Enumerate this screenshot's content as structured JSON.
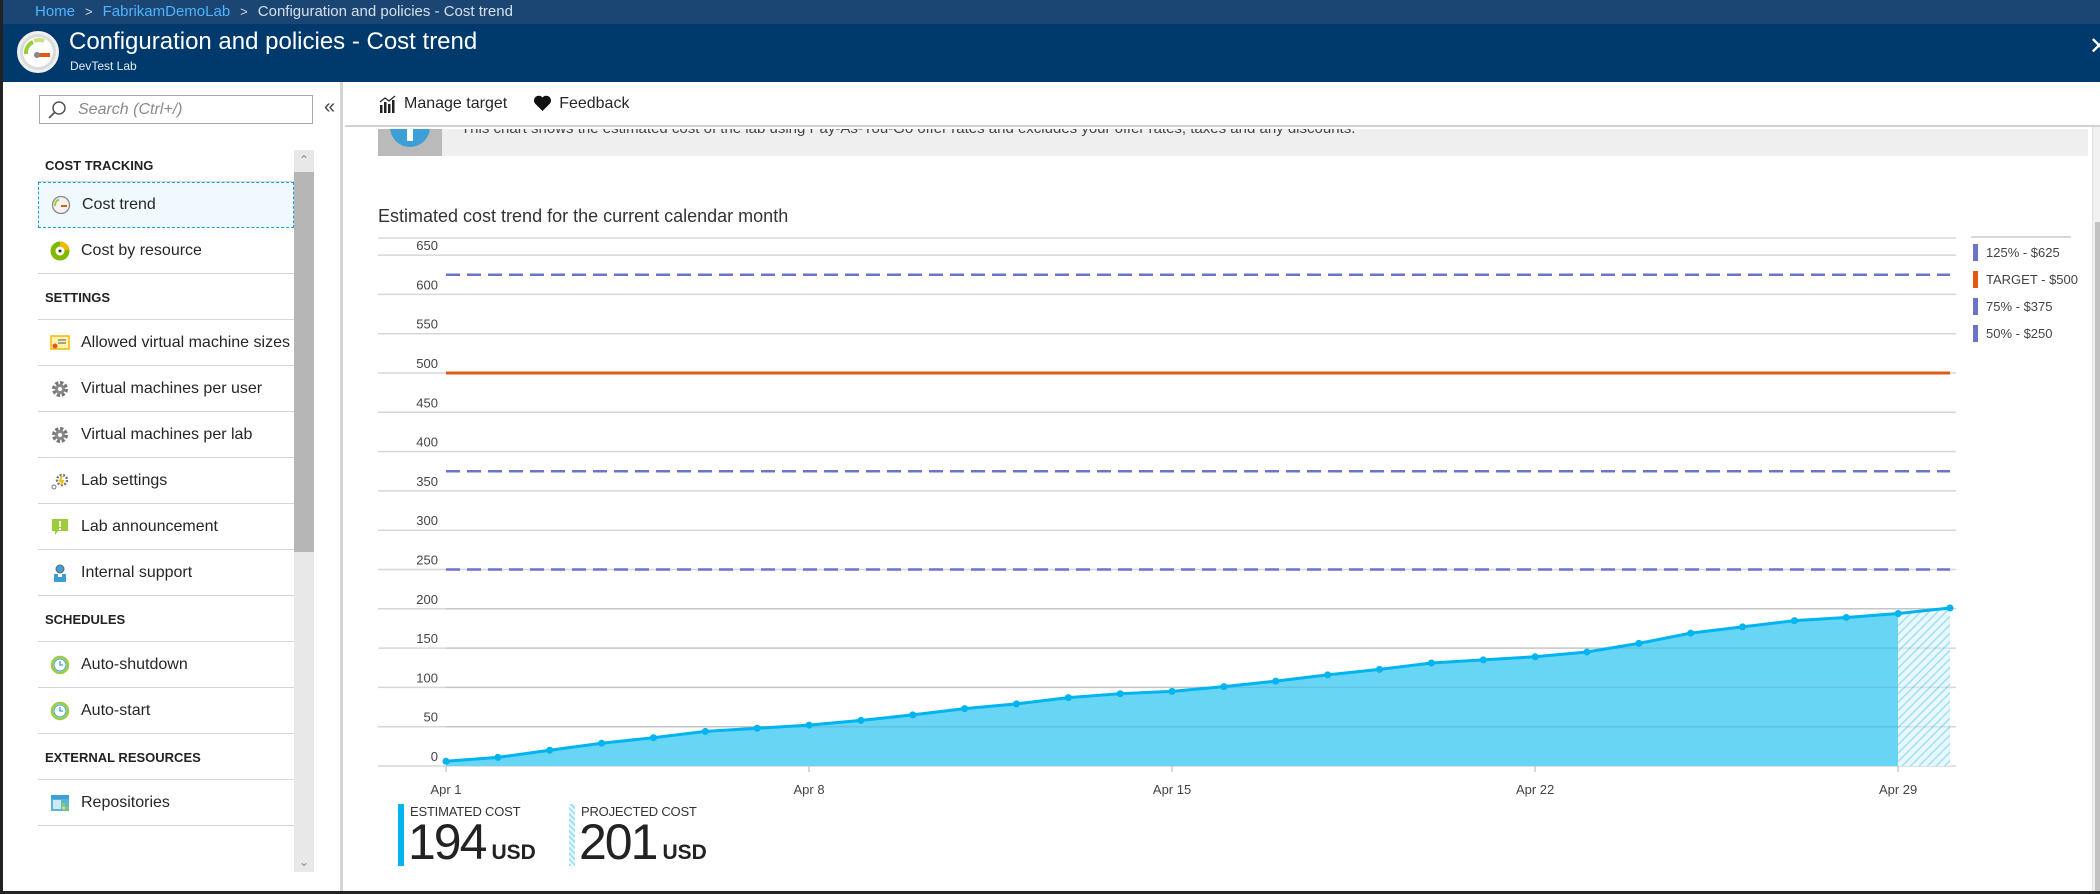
{
  "breadcrumb": [
    {
      "label": "Home",
      "link": true
    },
    {
      "label": "FabrikamDemoLab",
      "link": true
    },
    {
      "label": "Configuration and policies - Cost trend",
      "link": false
    }
  ],
  "header": {
    "title": "Configuration and policies - Cost trend",
    "subtitle": "DevTest Lab",
    "close_label": "✕"
  },
  "sidebar": {
    "search_placeholder": "Search (Ctrl+/)",
    "collapse_label": "«",
    "sections": [
      {
        "title": "COST TRACKING",
        "items": [
          {
            "label": "Cost trend",
            "icon": "gauge-icon",
            "active": true
          },
          {
            "label": "Cost by resource",
            "icon": "donut-chart-icon"
          }
        ]
      },
      {
        "title": "SETTINGS",
        "items": [
          {
            "label": "Allowed virtual machine sizes",
            "icon": "certificate-icon"
          },
          {
            "label": "Virtual machines per user",
            "icon": "gear-icon"
          },
          {
            "label": "Virtual machines per lab",
            "icon": "gear-icon"
          },
          {
            "label": "Lab settings",
            "icon": "lab-settings-icon"
          },
          {
            "label": "Lab announcement",
            "icon": "announcement-icon"
          },
          {
            "label": "Internal support",
            "icon": "support-person-icon"
          }
        ]
      },
      {
        "title": "SCHEDULES",
        "items": [
          {
            "label": "Auto-shutdown",
            "icon": "clock-icon"
          },
          {
            "label": "Auto-start",
            "icon": "clock-icon"
          }
        ]
      },
      {
        "title": "EXTERNAL RESOURCES",
        "items": [
          {
            "label": "Repositories",
            "icon": "repository-icon"
          }
        ]
      }
    ]
  },
  "toolbar": {
    "manage_target_label": "Manage target",
    "feedback_label": "Feedback"
  },
  "banner": {
    "text": "This chart shows the estimated cost of the lab using Pay-As-You-Go offer rates and excludes your offer rates, taxes and any discounts."
  },
  "summary": {
    "estimated": {
      "label": "ESTIMATED COST",
      "value": "194",
      "unit": "USD"
    },
    "projected": {
      "label": "PROJECTED COST",
      "value": "201",
      "unit": "USD"
    }
  },
  "colors": {
    "header_bg": "#003a6c",
    "breadcrumb_bg": "#1b4673",
    "link": "#4fb3ff",
    "area_fill": "#66d4f5",
    "line": "#00b4ef",
    "target": "#e25a10",
    "threshold": "#6b74c7"
  },
  "chart_data": {
    "type": "area",
    "title": "Estimated cost trend for the current calendar month",
    "xlabel": "",
    "ylabel": "",
    "x": [
      "Apr 1",
      "Apr 2",
      "Apr 3",
      "Apr 4",
      "Apr 5",
      "Apr 6",
      "Apr 7",
      "Apr 8",
      "Apr 9",
      "Apr 10",
      "Apr 11",
      "Apr 12",
      "Apr 13",
      "Apr 14",
      "Apr 15",
      "Apr 16",
      "Apr 17",
      "Apr 18",
      "Apr 19",
      "Apr 20",
      "Apr 21",
      "Apr 22",
      "Apr 23",
      "Apr 24",
      "Apr 25",
      "Apr 26",
      "Apr 27",
      "Apr 28",
      "Apr 29",
      "Apr 30"
    ],
    "x_tick_labels": [
      "Apr 1",
      "Apr 8",
      "Apr 15",
      "Apr 22",
      "Apr 29"
    ],
    "x_tick_indices": [
      0,
      7,
      14,
      21,
      28
    ],
    "y_ticks": [
      0,
      50,
      100,
      150,
      200,
      250,
      300,
      350,
      400,
      450,
      500,
      550,
      600,
      650
    ],
    "ylim": [
      0,
      680
    ],
    "grid": true,
    "series": [
      {
        "name": "Estimated cost",
        "kind": "actual",
        "values": [
          6,
          11,
          20,
          29,
          36,
          44,
          48,
          52,
          58,
          65,
          73,
          79,
          87,
          92,
          95,
          101,
          108,
          116,
          123,
          131,
          135,
          139,
          145,
          156,
          169,
          177,
          185,
          189,
          194
        ]
      },
      {
        "name": "Projected cost",
        "kind": "projected",
        "start_index": 28,
        "values": [
          194,
          201
        ]
      }
    ],
    "thresholds": [
      {
        "name": "125% - $625",
        "value": 625,
        "style": "dashed",
        "color": "#6b74c7"
      },
      {
        "name": "TARGET - $500",
        "value": 500,
        "style": "solid",
        "color": "#e25a10"
      },
      {
        "name": "75% - $375",
        "value": 375,
        "style": "dashed",
        "color": "#6b74c7"
      },
      {
        "name": "50% - $250",
        "value": 250,
        "style": "dashed",
        "color": "#6b74c7"
      }
    ],
    "legend_position": "right"
  }
}
